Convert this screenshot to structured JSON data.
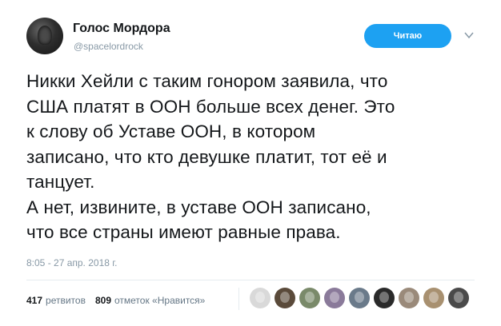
{
  "author": {
    "name": "Голос Мордора",
    "handle": "@spacelordrock"
  },
  "follow_button": {
    "label": "Читаю"
  },
  "tweet": {
    "lines": [
      "Никки Хейли с таким гонором заявила, что",
      "США платят в ООН больше всех денег. Это",
      "к слову об Уставе ООН, в котором",
      "записано, что кто девушке платит, тот её и",
      "танцует.",
      "А нет, извините, в уставе ООН записано,",
      "что все страны имеют равные права."
    ],
    "timestamp": "8:05 - 27 апр. 2018 г."
  },
  "stats": {
    "retweets_count": "417",
    "retweets_label": "ретвитов",
    "likes_count": "809",
    "likes_label": "отметок «Нравится»"
  },
  "likers": [
    {
      "icon": "avatar-icon",
      "color": "#d9d9d9"
    },
    {
      "icon": "avatar-icon",
      "color": "#5a4a3a"
    },
    {
      "icon": "avatar-icon",
      "color": "#7a8a6a"
    },
    {
      "icon": "avatar-icon",
      "color": "#8a7a9a"
    },
    {
      "icon": "avatar-icon",
      "color": "#6a7a8a"
    },
    {
      "icon": "avatar-icon",
      "color": "#2a2a2a"
    },
    {
      "icon": "avatar-icon",
      "color": "#9a8a7a"
    },
    {
      "icon": "avatar-icon",
      "color": "#a89070"
    },
    {
      "icon": "avatar-icon",
      "color": "#4a4a4a"
    }
  ],
  "colors": {
    "accent": "#1da1f2",
    "text": "#14171a",
    "muted": "#8899a6"
  }
}
